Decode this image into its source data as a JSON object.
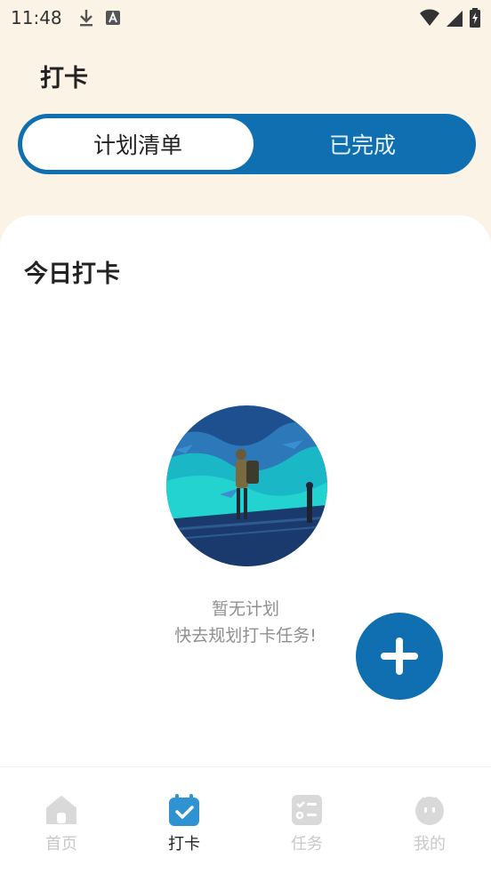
{
  "status_bar": {
    "time": "11:48"
  },
  "header": {
    "title": "打卡"
  },
  "segmented": {
    "active_label": "计划清单",
    "inactive_label": "已完成"
  },
  "card": {
    "title": "今日打卡",
    "empty_line1": "暂无计划",
    "empty_line2": "快去规划打卡任务!"
  },
  "tabbar": {
    "items": [
      {
        "label": "首页",
        "icon": "home-icon"
      },
      {
        "label": "打卡",
        "icon": "calendar-check-icon",
        "active": true
      },
      {
        "label": "任务",
        "icon": "task-list-icon"
      },
      {
        "label": "我的",
        "icon": "profile-face-icon"
      }
    ]
  },
  "colors": {
    "accent": "#0f6fb0",
    "background": "#fbf3e6",
    "inactive_tab": "#c8c8c8"
  }
}
